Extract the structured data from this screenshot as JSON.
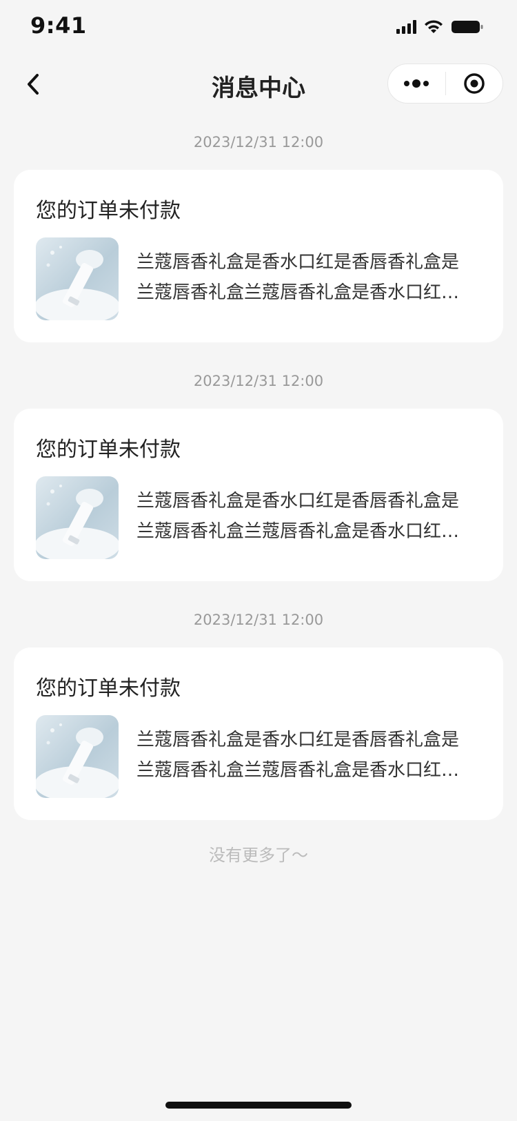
{
  "status_bar": {
    "time": "9:41"
  },
  "nav": {
    "title": "消息中心",
    "icons": {
      "back": "back-chevron-icon",
      "more": "more-dots-icon",
      "close": "target-circle-icon"
    }
  },
  "messages": [
    {
      "time": "2023/12/31 12:00",
      "title": "您的订单未付款",
      "description": "兰蔻唇香礼盒是香水口红是香唇香礼盒是兰蔻唇香礼盒兰蔻唇香礼盒是香水口红是香唇香礼盒"
    },
    {
      "time": "2023/12/31 12:00",
      "title": "您的订单未付款",
      "description": "兰蔻唇香礼盒是香水口红是香唇香礼盒是兰蔻唇香礼盒兰蔻唇香礼盒是香水口红是香唇香礼盒"
    },
    {
      "time": "2023/12/31 12:00",
      "title": "您的订单未付款",
      "description": "兰蔻唇香礼盒是香水口红是香唇香礼盒是兰蔻唇香礼盒兰蔻唇香礼盒是香水口红是香唇香礼盒"
    }
  ],
  "footer": {
    "no_more": "没有更多了～"
  },
  "colors": {
    "background": "#f5f5f5",
    "card": "#ffffff",
    "muted_text": "#999999"
  }
}
